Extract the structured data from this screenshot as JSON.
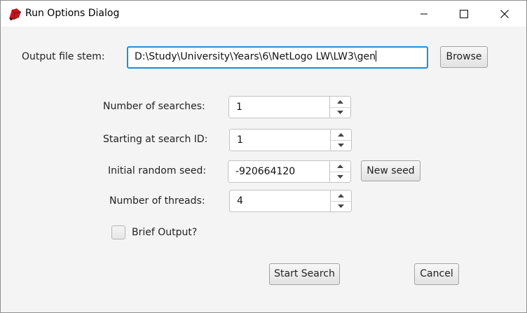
{
  "window": {
    "title": "Run Options Dialog",
    "icon": "netlogo-red-turtle-icon"
  },
  "window_controls": {
    "minimize": "minimize-icon",
    "maximize": "maximize-icon",
    "close": "close-icon"
  },
  "output": {
    "label": "Output file stem:",
    "value": "D:\\Study\\University\\Years\\6\\NetLogo LW\\LW3\\gen",
    "browse_label": "Browse"
  },
  "searches": {
    "label": "Number of searches:",
    "value": "1"
  },
  "start_id": {
    "label": "Starting at search ID:",
    "value": "1"
  },
  "seed": {
    "label": "Initial random seed:",
    "value": "-920664120",
    "new_seed_label": "New seed"
  },
  "threads": {
    "label": "Number of threads:",
    "value": "4"
  },
  "brief_output": {
    "label": "Brief Output?",
    "checked": false
  },
  "actions": {
    "start_label": "Start Search",
    "cancel_label": "Cancel"
  },
  "colors": {
    "focus_border": "#1e8fd6",
    "dialog_background": "#f4f4f4"
  }
}
